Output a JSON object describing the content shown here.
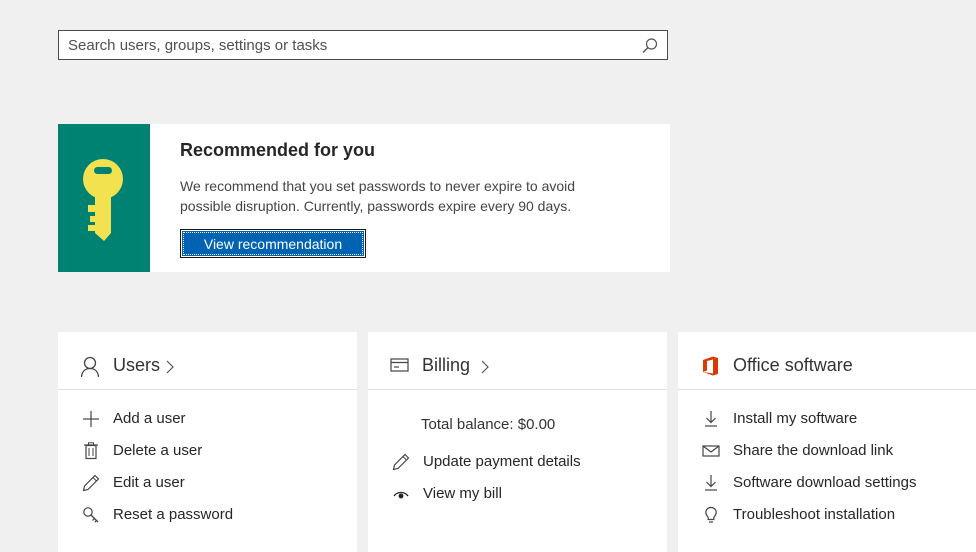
{
  "search": {
    "placeholder": "Search users, groups, settings or tasks",
    "icon": "search-icon"
  },
  "recommendation": {
    "title": "Recommended for you",
    "description": "We recommend that you set passwords to never expire to avoid possible disruption. Currently, passwords expire every 90 days.",
    "button_label": "View recommendation",
    "icon": "key-icon",
    "panel_color": "#008272",
    "key_color": "#f2e250",
    "button_color": "#0063b1"
  },
  "cards": {
    "users": {
      "title": "Users",
      "items": [
        {
          "label": "Add a user",
          "icon": "plus-icon"
        },
        {
          "label": "Delete a user",
          "icon": "trash-icon"
        },
        {
          "label": "Edit a user",
          "icon": "pencil-icon"
        },
        {
          "label": "Reset a password",
          "icon": "key-search-icon"
        }
      ]
    },
    "billing": {
      "title": "Billing",
      "balance": "Total balance: $0.00",
      "items": [
        {
          "label": "Update payment details",
          "icon": "pencil-icon"
        },
        {
          "label": "View my bill",
          "icon": "eye-icon"
        }
      ]
    },
    "office": {
      "title": "Office software",
      "accent": "#d83b01",
      "items": [
        {
          "label": "Install my software",
          "icon": "download-icon"
        },
        {
          "label": "Share the download link",
          "icon": "mail-icon"
        },
        {
          "label": "Software download settings",
          "icon": "download-icon"
        },
        {
          "label": "Troubleshoot installation",
          "icon": "lightbulb-icon"
        }
      ]
    }
  }
}
